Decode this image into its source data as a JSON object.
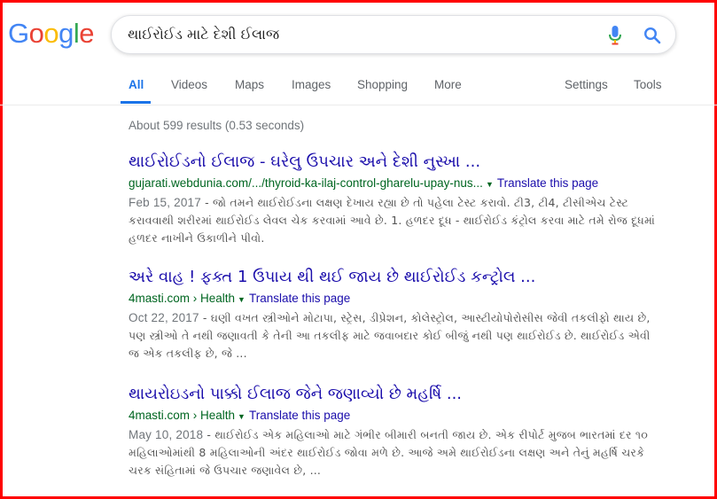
{
  "logo": {
    "letters": [
      "G",
      "o",
      "o",
      "g",
      "l",
      "e"
    ],
    "colors": [
      "#4285F4",
      "#EA4335",
      "#FBBC05",
      "#4285F4",
      "#34A853",
      "#EA4335"
    ]
  },
  "search": {
    "query": "થાઈરોઈડ માટે દેશી ઈલાજ",
    "mic_icon": "mic-icon",
    "search_icon": "search-icon"
  },
  "tabs": {
    "all": "All",
    "videos": "Videos",
    "maps": "Maps",
    "images": "Images",
    "shopping": "Shopping",
    "more": "More",
    "settings": "Settings",
    "tools": "Tools"
  },
  "stats": "About 599 results (0.53 seconds)",
  "results": [
    {
      "title": "થાઈરોઈડનો ઈલાજ - ઘરેલુ ઉપચાર અને દેશી નુસ્ખા ...",
      "url": "gujarati.webdunia.com/.../thyroid-ka-ilaj-control-gharelu-upay-nus...",
      "translate": "Translate this page",
      "date": "Feb 15, 2017",
      "snippet": " - જો તમને થાઈરોઈડના લક્ષણ દેખાય રહ્યા છે તો પહેલા ટેસ્ટ કરાવો. ટી3, ટી4, ટીસીએચ ટેસ્ટ કરાવવાથી શરીરમાં થાઈરોઈડ લેવલ ચેક કરવામાં આવે છે. 1. હળદર દૂધ - થાઈરોઈડ કંટ્રોલ કરવા માટે તમે રોજ દૂધમાં હળદર નાખીને ઉકાળીને પીવો."
    },
    {
      "title": "અરે વાહ ! ફક્ત 1 ઉપાય થી થઈ જાય છે થાઈરોઈડ કન્ટ્રોલ ...",
      "url": "4masti.com › Health",
      "translate": "Translate this page",
      "date": "Oct 22, 2017",
      "snippet": " - ઘણી વખત સ્ત્રીઓને મોટાપા, સ્ટ્રેસ, ડીપ્રેશન, કોલેસ્ટ્રોલ, આસ્ટીયોપોરોસીસ જેવી તકલીફો થાય છે, પણ સ્ત્રીઓ તે નથી જણાવતી કે તેની આ તકલીફ માટે જવાબદાર કોઈ બીજું નથી પણ થાઈરોઈડ છે. થાઈરોઈડ એવી જ એક તકલીફ છે, જે ..."
    },
    {
      "title": "થાયરોઇડનો પાક્કો ઈલાજ જેને જણાવ્યો છે મહર્ષિ ...",
      "url": "4masti.com › Health",
      "translate": "Translate this page",
      "date": "May 10, 2018",
      "snippet": " - થાઈરોઈડ એક મહિલાઓ માટે ગંભીર બીમારી બનતી જાય છે. એક રીપોર્ટ મુજબ ભારતમાં દર ૧૦ મહિલાઓમાંથી 8 મહિલાઓની અંદર થાઈરોઈડ જોવા મળે છે. આજે અમે થાઈરોઈડના લક્ષણ અને તેનું મહર્ષિ ચરકે ચરક સંહિતામાં જે ઉપચાર જણાવેલ છે, ..."
    }
  ]
}
